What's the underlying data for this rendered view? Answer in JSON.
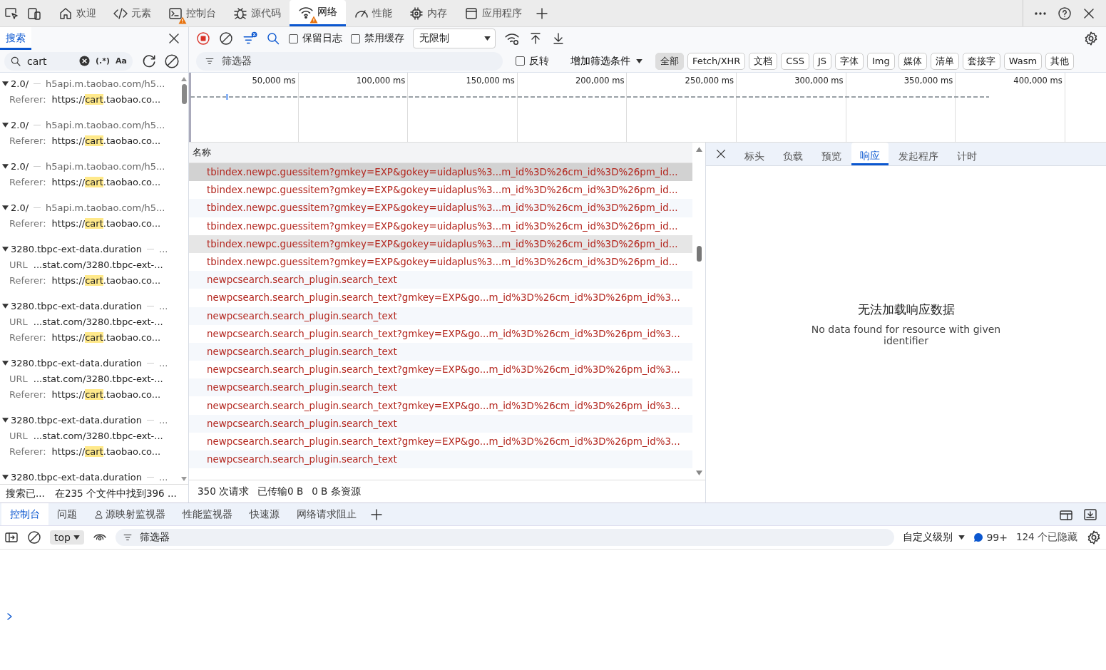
{
  "main_tabs": [
    {
      "label": "欢迎",
      "selected": false,
      "warning": false
    },
    {
      "label": "元素",
      "selected": false,
      "warning": false
    },
    {
      "label": "控制台",
      "selected": false,
      "warning": true
    },
    {
      "label": "源代码",
      "selected": false,
      "warning": false
    },
    {
      "label": "网络",
      "selected": true,
      "warning": true
    },
    {
      "label": "性能",
      "selected": false,
      "warning": false
    },
    {
      "label": "内存",
      "selected": false,
      "warning": false
    },
    {
      "label": "应用程序",
      "selected": false,
      "warning": false
    }
  ],
  "search_panel": {
    "tab": {
      "label": "搜索",
      "selected": true
    },
    "query": "cart",
    "regex_label": "(.*)",
    "case_label": "Aa",
    "results": [
      {
        "title": "2.0/",
        "source": "h5api.m.taobao.com/h5...",
        "lines": [
          {
            "label": "Referer:",
            "pre": "https://",
            "match": "cart",
            "post": ".taobao.co..."
          }
        ]
      },
      {
        "title": "2.0/",
        "source": "h5api.m.taobao.com/h5...",
        "lines": [
          {
            "label": "Referer:",
            "pre": "https://",
            "match": "cart",
            "post": ".taobao.co..."
          }
        ]
      },
      {
        "title": "2.0/",
        "source": "h5api.m.taobao.com/h5...",
        "lines": [
          {
            "label": "Referer:",
            "pre": "https://",
            "match": "cart",
            "post": ".taobao.co..."
          }
        ]
      },
      {
        "title": "2.0/",
        "source": "h5api.m.taobao.com/h5...",
        "lines": [
          {
            "label": "Referer:",
            "pre": "https://",
            "match": "cart",
            "post": ".taobao.co..."
          }
        ]
      },
      {
        "title": "3280.tbpc-ext-data.duration",
        "source": "...",
        "lines": [
          {
            "label": "URL",
            "pre": "...stat.com/3280.tbpc-ext-..."
          },
          {
            "label": "Referer:",
            "pre": "https://",
            "match": "cart",
            "post": ".taobao.co..."
          }
        ]
      },
      {
        "title": "3280.tbpc-ext-data.duration",
        "source": "...",
        "lines": [
          {
            "label": "URL",
            "pre": "...stat.com/3280.tbpc-ext-..."
          },
          {
            "label": "Referer:",
            "pre": "https://",
            "match": "cart",
            "post": ".taobao.co..."
          }
        ]
      },
      {
        "title": "3280.tbpc-ext-data.duration",
        "source": "...",
        "lines": [
          {
            "label": "URL",
            "pre": "...stat.com/3280.tbpc-ext-..."
          },
          {
            "label": "Referer:",
            "pre": "https://",
            "match": "cart",
            "post": ".taobao.co..."
          }
        ]
      },
      {
        "title": "3280.tbpc-ext-data.duration",
        "source": "...",
        "lines": [
          {
            "label": "URL",
            "pre": "...stat.com/3280.tbpc-ext-..."
          },
          {
            "label": "Referer:",
            "pre": "https://",
            "match": "cart",
            "post": ".taobao.co..."
          }
        ]
      },
      {
        "title": "3280.tbpc-ext-data.duration",
        "source": "..."
      }
    ],
    "status": [
      "搜索已...",
      "在235 个文件中找到396 ..."
    ]
  },
  "network_toolbar": {
    "preserve_log": {
      "label": "保留日志",
      "checked": false
    },
    "disable_cache": {
      "label": "禁用缓存",
      "checked": false
    },
    "throttling": "无限制"
  },
  "filter_bar": {
    "placeholder": "筛选器",
    "invert": {
      "label": "反转",
      "checked": false
    },
    "more_filters": "增加筛选条件",
    "types": [
      {
        "label": "全部",
        "selected": true
      },
      {
        "label": "Fetch/XHR",
        "selected": false
      },
      {
        "label": "文档",
        "selected": false
      },
      {
        "label": "CSS",
        "selected": false
      },
      {
        "label": "JS",
        "selected": false
      },
      {
        "label": "字体",
        "selected": false
      },
      {
        "label": "Img",
        "selected": false
      },
      {
        "label": "媒体",
        "selected": false
      },
      {
        "label": "清单",
        "selected": false
      },
      {
        "label": "套接字",
        "selected": false
      },
      {
        "label": "Wasm",
        "selected": false
      },
      {
        "label": "其他",
        "selected": false
      }
    ]
  },
  "timeline": {
    "ticks": [
      "50,000 ms",
      "100,000 ms",
      "150,000 ms",
      "200,000 ms",
      "250,000 ms",
      "300,000 ms",
      "350,000 ms",
      "400,000 ms"
    ]
  },
  "requests": {
    "column": "名称",
    "rows": [
      {
        "name": "tbindex.newpc.guessitem?gmkey=EXP&gokey=uidaplus%3...m_id%3D%26cm_id%3D%26pm_id...",
        "selected": true,
        "hovered": false
      },
      {
        "name": "tbindex.newpc.guessitem?gmkey=EXP&gokey=uidaplus%3...m_id%3D%26cm_id%3D%26pm_id...",
        "selected": false,
        "hovered": false
      },
      {
        "name": "tbindex.newpc.guessitem?gmkey=EXP&gokey=uidaplus%3...m_id%3D%26cm_id%3D%26pm_id...",
        "selected": false,
        "hovered": false
      },
      {
        "name": "tbindex.newpc.guessitem?gmkey=EXP&gokey=uidaplus%3...m_id%3D%26cm_id%3D%26pm_id...",
        "selected": false,
        "hovered": false
      },
      {
        "name": "tbindex.newpc.guessitem?gmkey=EXP&gokey=uidaplus%3...m_id%3D%26cm_id%3D%26pm_id...",
        "selected": false,
        "hovered": true
      },
      {
        "name": "tbindex.newpc.guessitem?gmkey=EXP&gokey=uidaplus%3...m_id%3D%26cm_id%3D%26pm_id...",
        "selected": false,
        "hovered": false
      },
      {
        "name": "newpcsearch.search_plugin.search_text",
        "selected": false,
        "hovered": false
      },
      {
        "name": "newpcsearch.search_plugin.search_text?gmkey=EXP&go...m_id%3D%26cm_id%3D%26pm_id%3...",
        "selected": false,
        "hovered": false
      },
      {
        "name": "newpcsearch.search_plugin.search_text",
        "selected": false,
        "hovered": false
      },
      {
        "name": "newpcsearch.search_plugin.search_text?gmkey=EXP&go...m_id%3D%26cm_id%3D%26pm_id%3...",
        "selected": false,
        "hovered": false
      },
      {
        "name": "newpcsearch.search_plugin.search_text",
        "selected": false,
        "hovered": false
      },
      {
        "name": "newpcsearch.search_plugin.search_text?gmkey=EXP&go...m_id%3D%26cm_id%3D%26pm_id%3...",
        "selected": false,
        "hovered": false
      },
      {
        "name": "newpcsearch.search_plugin.search_text",
        "selected": false,
        "hovered": false
      },
      {
        "name": "newpcsearch.search_plugin.search_text?gmkey=EXP&go...m_id%3D%26cm_id%3D%26pm_id%3...",
        "selected": false,
        "hovered": false
      },
      {
        "name": "newpcsearch.search_plugin.search_text",
        "selected": false,
        "hovered": false
      },
      {
        "name": "newpcsearch.search_plugin.search_text?gmkey=EXP&go...m_id%3D%26cm_id%3D%26pm_id%3...",
        "selected": false,
        "hovered": false
      },
      {
        "name": "newpcsearch.search_plugin.search_text",
        "selected": false,
        "hovered": false
      }
    ],
    "status": [
      "350 次请求",
      "已传输0 B",
      "0 B 条资源"
    ]
  },
  "detail": {
    "tabs": [
      {
        "label": "标头",
        "selected": false
      },
      {
        "label": "负载",
        "selected": false
      },
      {
        "label": "预览",
        "selected": false
      },
      {
        "label": "响应",
        "selected": true
      },
      {
        "label": "发起程序",
        "selected": false
      },
      {
        "label": "计时",
        "selected": false
      }
    ],
    "empty_title": "无法加载响应数据",
    "empty_message": "No data found for resource with given identifier"
  },
  "drawer": {
    "tabs": [
      {
        "label": "控制台",
        "selected": true
      },
      {
        "label": "问题",
        "selected": false
      },
      {
        "label": "源映射监视器",
        "selected": false
      },
      {
        "label": "性能监视器",
        "selected": false
      },
      {
        "label": "快速源",
        "selected": false
      },
      {
        "label": "网络请求阻止",
        "selected": false
      }
    ],
    "context": "top",
    "filter_placeholder": "筛选器",
    "levels": "自定义级别",
    "message_count": "99+",
    "hidden": "124 个已隐藏"
  }
}
